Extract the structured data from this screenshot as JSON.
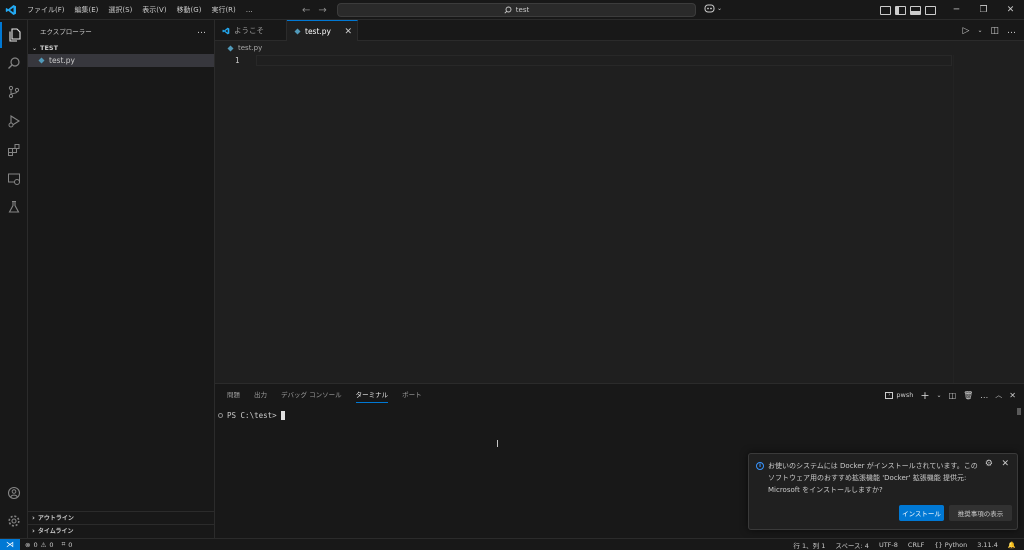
{
  "titlebar": {
    "menu": [
      "ファイル(F)",
      "編集(E)",
      "選択(S)",
      "表示(V)",
      "移動(G)",
      "実行(R)",
      "…"
    ],
    "search_text": "test"
  },
  "sidebar": {
    "title": "エクスプローラー",
    "more": "…",
    "folder": "TEST",
    "files": [
      {
        "name": "test.py"
      }
    ],
    "outline": "アウトライン",
    "timeline": "タイムライン"
  },
  "tabs": [
    {
      "label": "ようこそ"
    },
    {
      "label": "test.py"
    }
  ],
  "breadcrumb": {
    "file": "test.py"
  },
  "editor": {
    "line_number": "1"
  },
  "panel": {
    "tabs": [
      "問題",
      "出力",
      "デバッグ コンソール",
      "ターミナル",
      "ポート"
    ],
    "active_tab": "ターミナル",
    "shell": "pwsh",
    "prompt": "PS C:\\test>"
  },
  "notification": {
    "message": "お使いのシステムには Docker がインストールされています。このソフトウェア用のおすすめ拡張機能 'Docker' 拡張機能 提供元: Microsoft をインストールしますか?",
    "install_label": "インストール",
    "show_recommendations_label": "推奨事項の表示"
  },
  "statusbar": {
    "errors": "0",
    "warnings": "0",
    "ports": "0",
    "position": "行 1、列 1",
    "spaces": "スペース: 4",
    "encoding": "UTF-8",
    "eol": "CRLF",
    "language": "Python",
    "python_version": "3.11.4"
  },
  "colors": {
    "accent": "#0078d4",
    "python_icon": "#519aba",
    "vscode_logo": "#23a9f2"
  }
}
